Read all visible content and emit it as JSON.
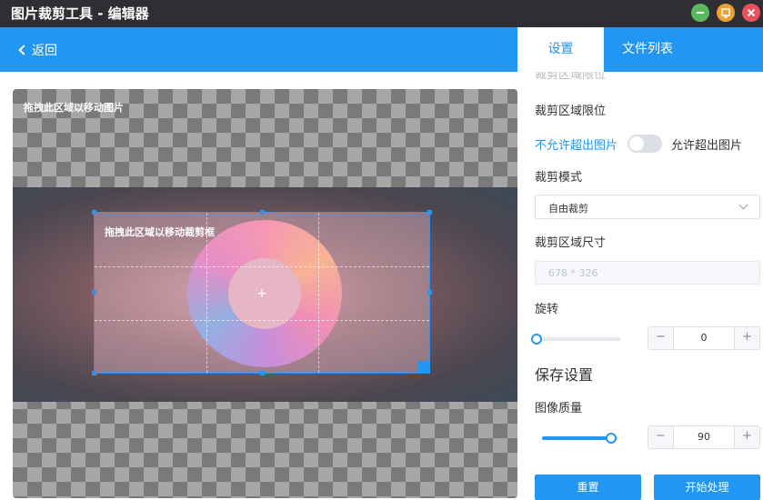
{
  "window": {
    "title": "图片裁剪工具 - 编辑器",
    "buttons": [
      "minimize",
      "restore",
      "close"
    ]
  },
  "toolbar": {
    "back_label": "返回",
    "tabs": [
      {
        "label": "设置",
        "active": true
      },
      {
        "label": "文件列表",
        "active": false
      }
    ]
  },
  "canvas": {
    "move_image_hint": "拖拽此区域以移动图片",
    "move_crop_hint": "拖拽此区域以移动裁剪框"
  },
  "settings": {
    "crop_limit_label": "裁剪区域限位",
    "limit_off_label": "不允许超出图片",
    "limit_on_label": "允许超出图片",
    "limit_enabled": false,
    "crop_mode_label": "裁剪模式",
    "crop_mode_value": "自由裁剪",
    "crop_size_label": "裁剪区域尺寸",
    "crop_size_value": "678 * 326",
    "rotate_label": "旋转",
    "rotate_value": "0",
    "rotate_fraction": 0.0,
    "save_section_title": "保存设置",
    "quality_label": "图像质量",
    "quality_value": "90",
    "quality_fraction": 0.9,
    "reset_button": "重置",
    "start_button": "开始处理"
  },
  "colors": {
    "accent": "#2196f3",
    "titlebar": "#2f2f33",
    "minimize": "#5cb85c",
    "restore": "#f0a030",
    "close": "#e8505b"
  },
  "icons": [
    "chevron-left-icon",
    "minimize-icon",
    "restore-icon",
    "close-icon",
    "chevron-down-icon",
    "crosshair-icon"
  ]
}
